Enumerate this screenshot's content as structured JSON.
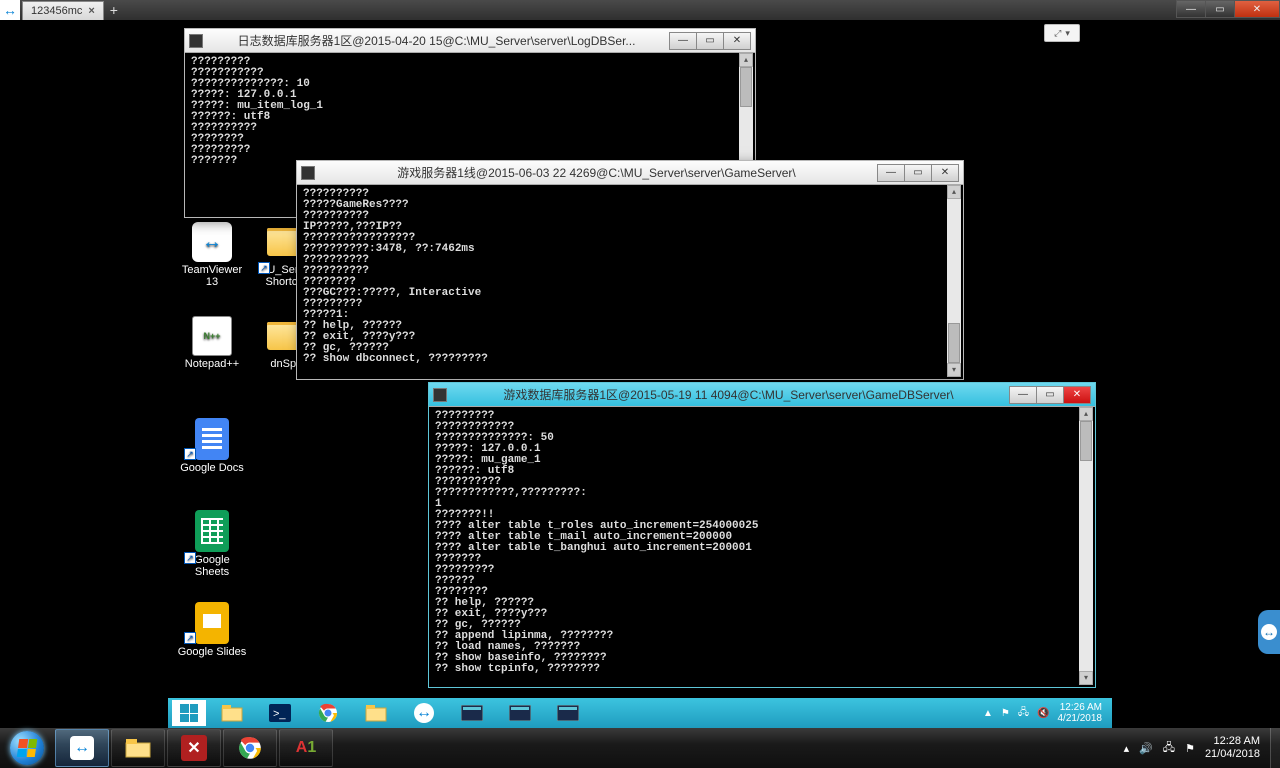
{
  "host": {
    "tab_label": "123456mc",
    "tray": {
      "time": "12:28 AM",
      "date": "21/04/2018"
    }
  },
  "remote": {
    "icons": {
      "teamviewer": "TeamViewer 13",
      "mu_server": "MU_Server Shortcut",
      "notepadpp": "Notepad++",
      "dnspy": "dnSpy",
      "gdocs": "Google Docs",
      "gsheets": "Google Sheets",
      "gslides": "Google Slides"
    },
    "taskbar_tray": {
      "time": "12:26 AM",
      "date": "4/21/2018"
    }
  },
  "win_log": {
    "title": "日志数据库服务器1区@2015-04-20 15@C:\\MU_Server\\server\\LogDBSer...",
    "body": "?????????\n???????????\n??????????????: 10\n?????: 127.0.0.1\n?????: mu_item_log_1\n??????: utf8\n??????????\n????????\n?????????\n???????"
  },
  "win_game": {
    "title": "游戏服务器1线@2015-06-03 22 4269@C:\\MU_Server\\server\\GameServer\\",
    "body": "??????????\n?????GameRes????\n??????????\nIP?????,???IP??\n?????????????????\n??????????:3478, ??:7462ms\n??????????\n??????????\n????????\n???GC???:?????, Interactive\n?????????\n?????1:\n?? help, ??????\n?? exit, ????y???\n?? gc, ??????\n?? show dbconnect, ?????????"
  },
  "win_db": {
    "title": "游戏数据库服务器1区@2015-05-19 11 4094@C:\\MU_Server\\server\\GameDBServer\\",
    "body": "?????????\n????????????\n??????????????: 50\n?????: 127.0.0.1\n?????: mu_game_1\n??????: utf8\n??????????\n????????????,?????????:\n1\n???????!!\n???? alter table t_roles auto_increment=254000025\n???? alter table t_mail auto_increment=200000\n???? alter table t_banghui auto_increment=200001\n???????\n?????????\n??????\n????????\n?? help, ??????\n?? exit, ????y???\n?? gc, ??????\n?? append lipinma, ????????\n?? load names, ???????\n?? show baseinfo, ????????\n?? show tcpinfo, ????????"
  }
}
